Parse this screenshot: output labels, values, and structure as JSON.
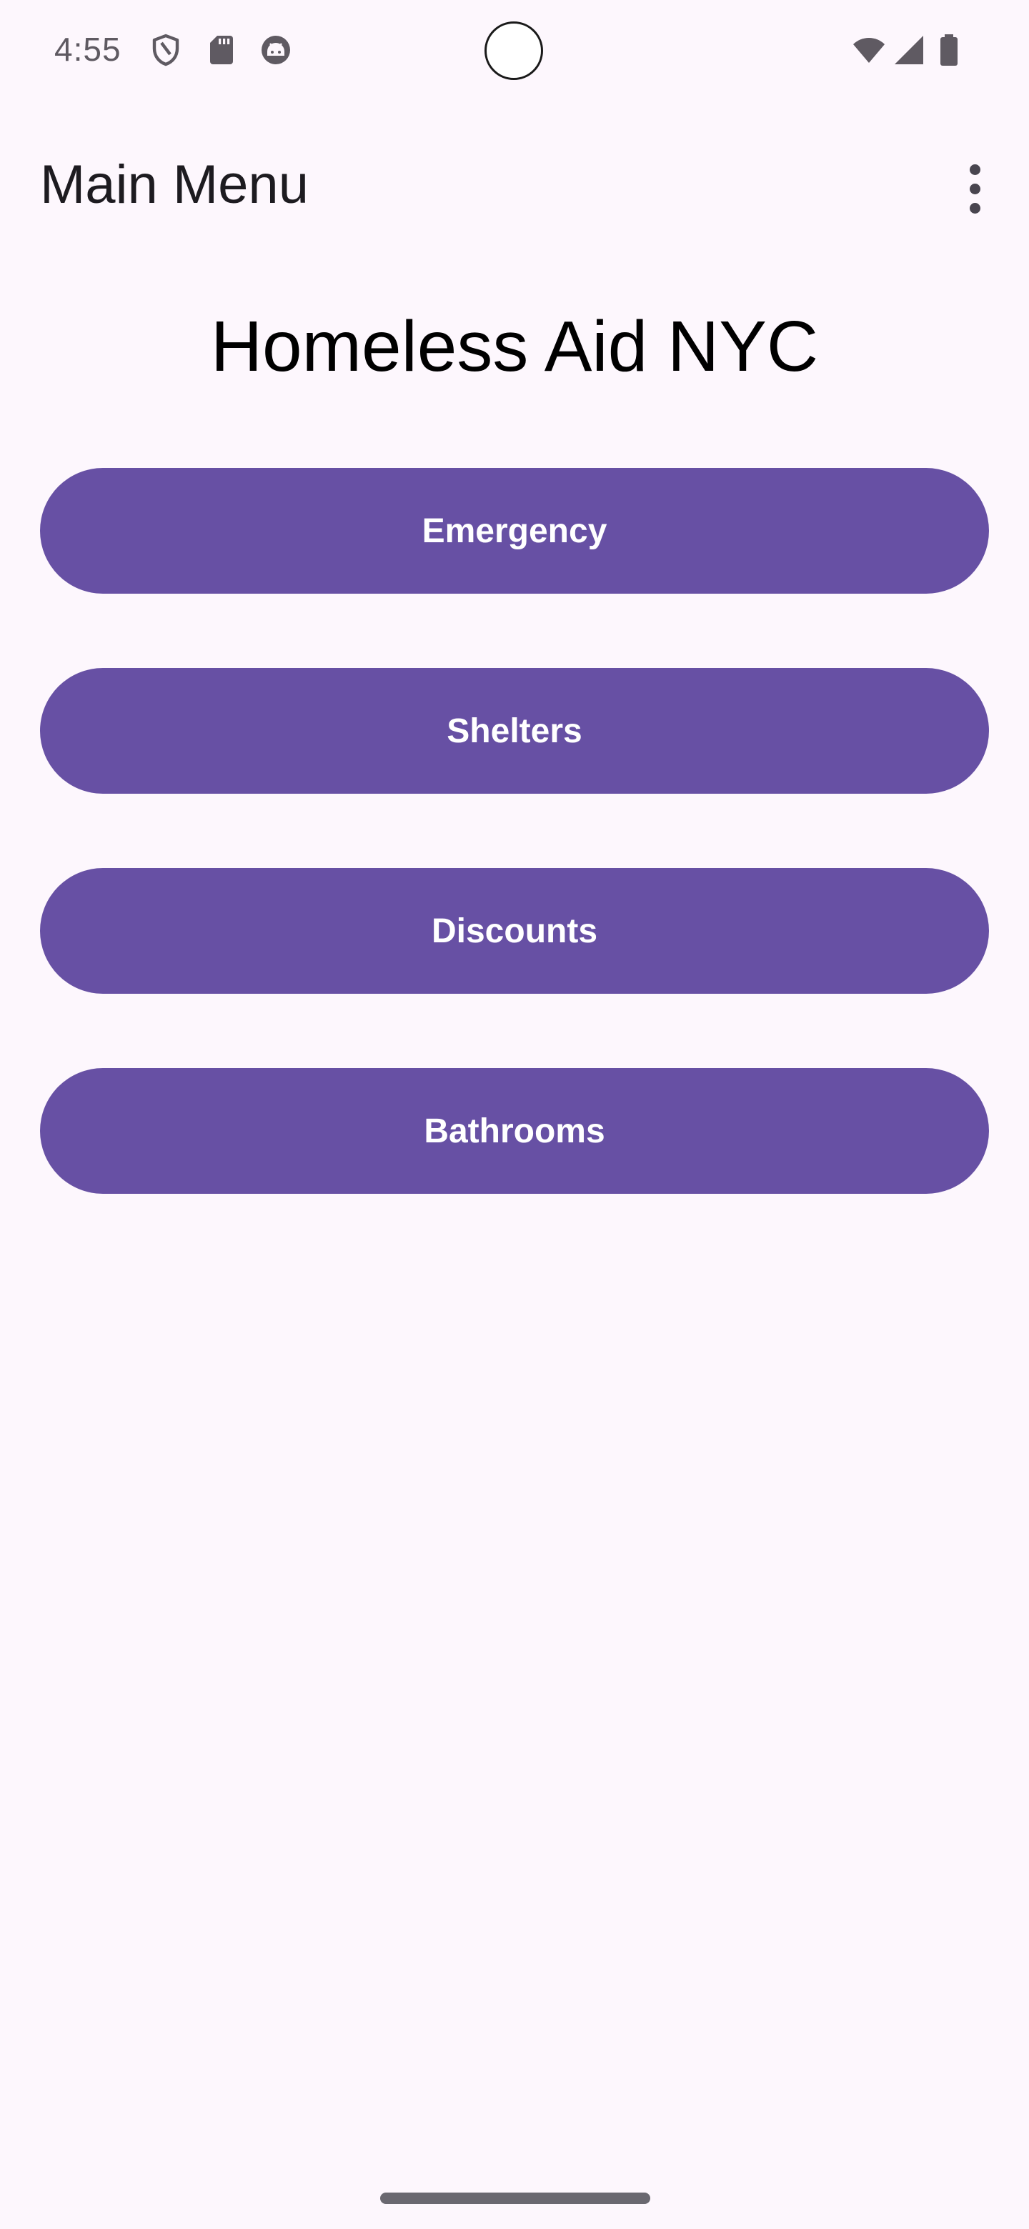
{
  "status_bar": {
    "time": "4:55",
    "left_icons": [
      "shield-icon",
      "sd-card-icon",
      "android-face-icon"
    ],
    "right_icons": [
      "wifi-icon",
      "cell-signal-icon",
      "battery-icon"
    ]
  },
  "app_bar": {
    "title": "Main Menu",
    "overflow_icon": "more-vert-icon"
  },
  "main": {
    "heading": "Homeless Aid NYC",
    "buttons": [
      {
        "label": "Emergency"
      },
      {
        "label": "Shelters"
      },
      {
        "label": "Discounts"
      },
      {
        "label": "Bathrooms"
      }
    ]
  },
  "colors": {
    "background": "#FDF7FD",
    "button": "#6750A4",
    "button_text": "#FFFFFF",
    "status_icons": "#5F5A62"
  }
}
